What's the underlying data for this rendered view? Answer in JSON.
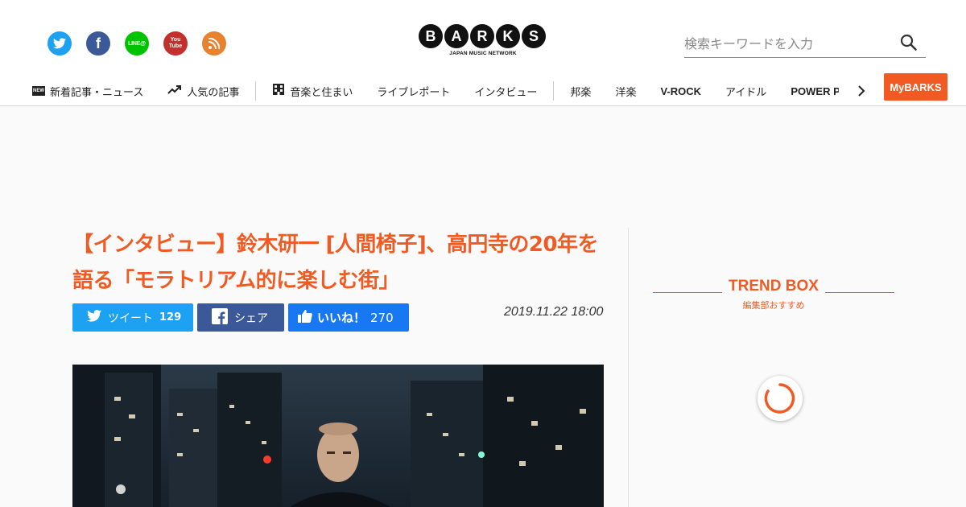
{
  "header": {
    "social_icons": [
      {
        "name": "twitter-icon",
        "color": "#1da1f2"
      },
      {
        "name": "facebook-icon",
        "color": "#3b5998",
        "glyph": "f"
      },
      {
        "name": "line-icon",
        "color": "#00c300",
        "glyph": "LINE@"
      },
      {
        "name": "youtube-icon",
        "color": "#c4302b",
        "glyph_top": "You",
        "glyph_bottom": "Tube"
      },
      {
        "name": "rss-icon",
        "color": "#e8822e"
      }
    ],
    "logo": {
      "letters": [
        "B",
        "A",
        "R",
        "K",
        "S"
      ],
      "tagline": "JAPAN MUSIC NETWORK"
    },
    "search": {
      "placeholder": "検索キーワードを入力"
    },
    "nav": {
      "items": [
        {
          "label": "新着記事・ニュース",
          "icon": "new-icon",
          "badge": "NEW"
        },
        {
          "label": "人気の記事",
          "icon": "trending-icon"
        },
        {
          "label": "音楽と住まい",
          "icon": "building-icon"
        },
        {
          "label": "ライブレポート"
        },
        {
          "label": "インタビュー"
        },
        {
          "label": "邦楽"
        },
        {
          "label": "洋楽"
        },
        {
          "label": "V-ROCK"
        },
        {
          "label": "アイドル"
        },
        {
          "label": "POWER P"
        }
      ],
      "mybarks": "MyBARKS"
    }
  },
  "article": {
    "title": "【インタビュー】鈴木研一 [人間椅子]、高円寺の20年を語る「モラトリアム的に楽しむ街」",
    "share": {
      "tweet_label": "ツイート",
      "tweet_count": "129",
      "facebook_label": "シェア",
      "like_label": "いいね！",
      "like_count": "270"
    },
    "date": "2019.11.22 18:00"
  },
  "sidebar": {
    "trend_title": "TREND BOX",
    "trend_subtitle": "編集部おすすめ"
  },
  "colors": {
    "accent": "#f15a22",
    "twitter": "#1da1f2",
    "facebook": "#3b5998",
    "like": "#1877f2"
  }
}
